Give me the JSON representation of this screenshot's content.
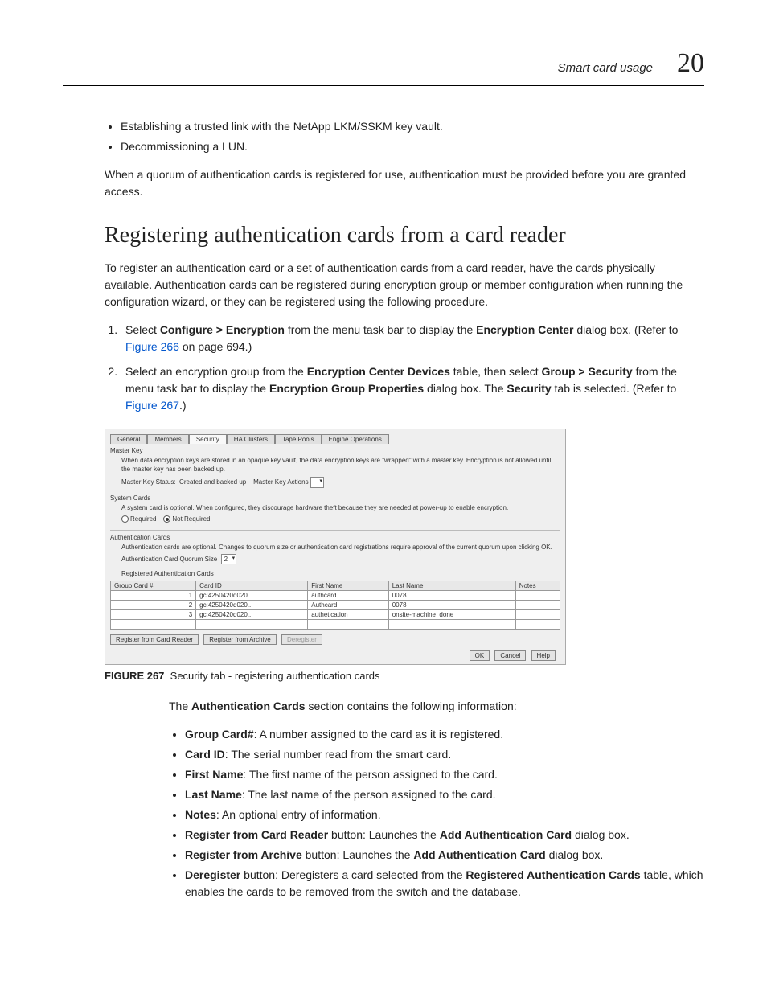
{
  "header": {
    "title": "Smart card usage",
    "chapter": "20"
  },
  "top_bullets": [
    "Establishing a trusted link with the NetApp LKM/SSKM key vault.",
    "Decommissioning a LUN."
  ],
  "top_para": "When a quorum of authentication cards is registered for use, authentication must be provided before you are granted access.",
  "h2": "Registering authentication cards from a card reader",
  "intro": "To register an authentication card or a set of authentication cards from a card reader, have the cards physically available. Authentication cards can be registered during encryption group or member configuration when running the configuration wizard, or they can be registered using the following procedure.",
  "steps": {
    "s1_a": "Select ",
    "s1_b": "Configure > Encryption",
    "s1_c": " from the menu task bar to display the ",
    "s1_d": "Encryption Center",
    "s1_e": " dialog box. (Refer to ",
    "s1_link": "Figure 266",
    "s1_f": " on page 694.)",
    "s2_a": "Select an encryption group from the ",
    "s2_b": "Encryption Center Devices",
    "s2_c": " table, then select ",
    "s2_d": "Group > Security",
    "s2_e": " from the menu task bar to display the ",
    "s2_f": "Encryption Group Properties",
    "s2_g": " dialog box. The ",
    "s2_h": "Security",
    "s2_i": " tab is selected. (Refer to ",
    "s2_link": "Figure 267",
    "s2_j": ".)"
  },
  "dialog": {
    "tabs": [
      "General",
      "Members",
      "Security",
      "HA Clusters",
      "Tape Pools",
      "Engine Operations"
    ],
    "active_tab": 2,
    "master_key_label": "Master Key",
    "master_key_desc": "When data encryption keys are stored in an opaque key vault, the data encryption keys are \"wrapped\" with a master key. Encryption is not allowed until the master key has been backed up.",
    "mk_status_label": "Master Key Status:",
    "mk_status_value": "Created and backed up",
    "mk_actions_label": "Master Key Actions",
    "system_cards_label": "System Cards",
    "system_cards_desc": "A system card is optional. When configured, they discourage hardware theft because they are needed at power-up to enable encryption.",
    "sc_req": "Required",
    "sc_notreq": "Not Required",
    "auth_cards_label": "Authentication Cards",
    "auth_cards_desc": "Authentication cards are optional. Changes to quorum size or authentication card registrations require approval of the current quorum upon clicking OK.",
    "quorum_label": "Authentication Card Quorum Size",
    "quorum_value": "2",
    "reg_label": "Registered Authentication Cards",
    "cols": [
      "Group Card #",
      "Card ID",
      "First Name",
      "Last Name",
      "Notes"
    ],
    "rows": [
      [
        "1",
        "gc:4250420d020...",
        "authcard",
        "0078",
        ""
      ],
      [
        "2",
        "gc:4250420d020...",
        "Authcard",
        "0078",
        ""
      ],
      [
        "3",
        "gc:4250420d020...",
        "authetication",
        "onsite-machine_done",
        ""
      ]
    ],
    "btn_reg_reader": "Register from Card Reader",
    "btn_reg_archive": "Register from Archive",
    "btn_dereg": "Deregister",
    "btn_ok": "OK",
    "btn_cancel": "Cancel",
    "btn_help": "Help"
  },
  "caption": {
    "label": "FIGURE 267",
    "text": "Security tab - registering authentication cards"
  },
  "after_para_a": "The ",
  "after_para_b": "Authentication Cards",
  "after_para_c": " section contains the following information:",
  "info_items": [
    {
      "b": "Group Card#",
      "t": ": A number assigned to the card as it is registered."
    },
    {
      "b": "Card ID",
      "t": ": The serial number read from the smart card."
    },
    {
      "b": "First Name",
      "t": ": The first name of the person assigned to the card."
    },
    {
      "b": "Last Name",
      "t": ": The last name of the person assigned to the card."
    },
    {
      "b": "Notes",
      "t": ": An optional entry of information."
    },
    {
      "b": "Register from Card Reader",
      "t": " button: Launches the ",
      "b2": "Add Authentication Card",
      "t2": " dialog box."
    },
    {
      "b": "Register from Archive",
      "t": " button: Launches the ",
      "b2": "Add Authentication Card",
      "t2": " dialog box."
    },
    {
      "b": "Deregister",
      "t": " button: Deregisters a card selected from the ",
      "b2": "Registered Authentication Cards",
      "t2": " table, which enables the cards to be removed from the switch and the database."
    }
  ]
}
